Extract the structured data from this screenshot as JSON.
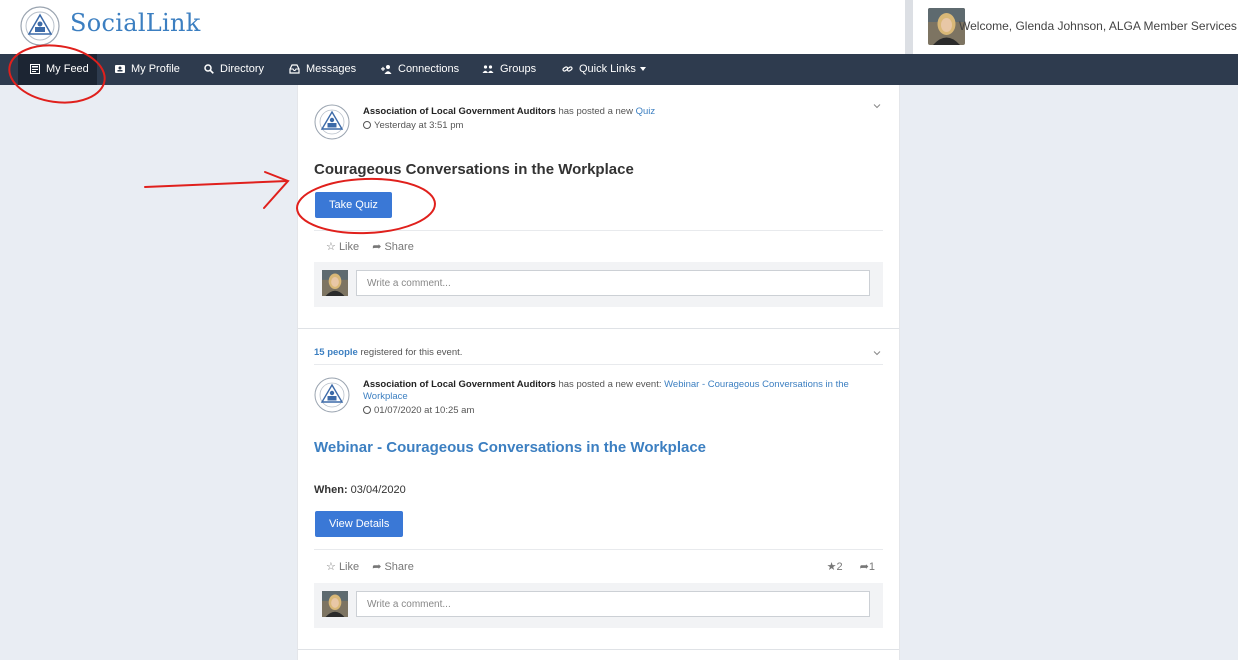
{
  "header": {
    "brand": "SocialLink",
    "welcome": "Welcome, Glenda Johnson, ALGA Member Services"
  },
  "nav": {
    "items": [
      {
        "label": "My Feed",
        "icon": "feed-icon"
      },
      {
        "label": "My Profile",
        "icon": "profile-card-icon"
      },
      {
        "label": "Directory",
        "icon": "search-icon"
      },
      {
        "label": "Messages",
        "icon": "inbox-icon"
      },
      {
        "label": "Connections",
        "icon": "add-user-icon"
      },
      {
        "label": "Groups",
        "icon": "group-icon"
      },
      {
        "label": "Quick Links",
        "icon": "link-icon"
      }
    ]
  },
  "posts": [
    {
      "author": "Association of Local Government Auditors",
      "action": "has posted a new",
      "link": "Quiz",
      "time": "Yesterday at 3:51 pm",
      "title": "Courageous Conversations in the Workplace",
      "button": "Take Quiz",
      "like": "Like",
      "share": "Share",
      "comment_placeholder": "Write a comment..."
    },
    {
      "registered_count": "15 people",
      "registered_text": "registered for this event.",
      "author": "Association of Local Government Auditors",
      "action": "has posted a new event:",
      "link": "Webinar - Courageous Conversations in the Workplace",
      "time": "01/07/2020 at 10:25 am",
      "title": "Webinar - Courageous Conversations in the Workplace",
      "when_label": "When:",
      "when_value": "03/04/2020",
      "button": "View Details",
      "like": "Like",
      "share": "Share",
      "like_count": "2",
      "share_count": "1",
      "comment_placeholder": "Write a comment..."
    }
  ],
  "colors": {
    "accent": "#3a78d6",
    "brand": "#3c7fc1",
    "nav": "#2e3b4e",
    "annotation": "#e0201c"
  }
}
